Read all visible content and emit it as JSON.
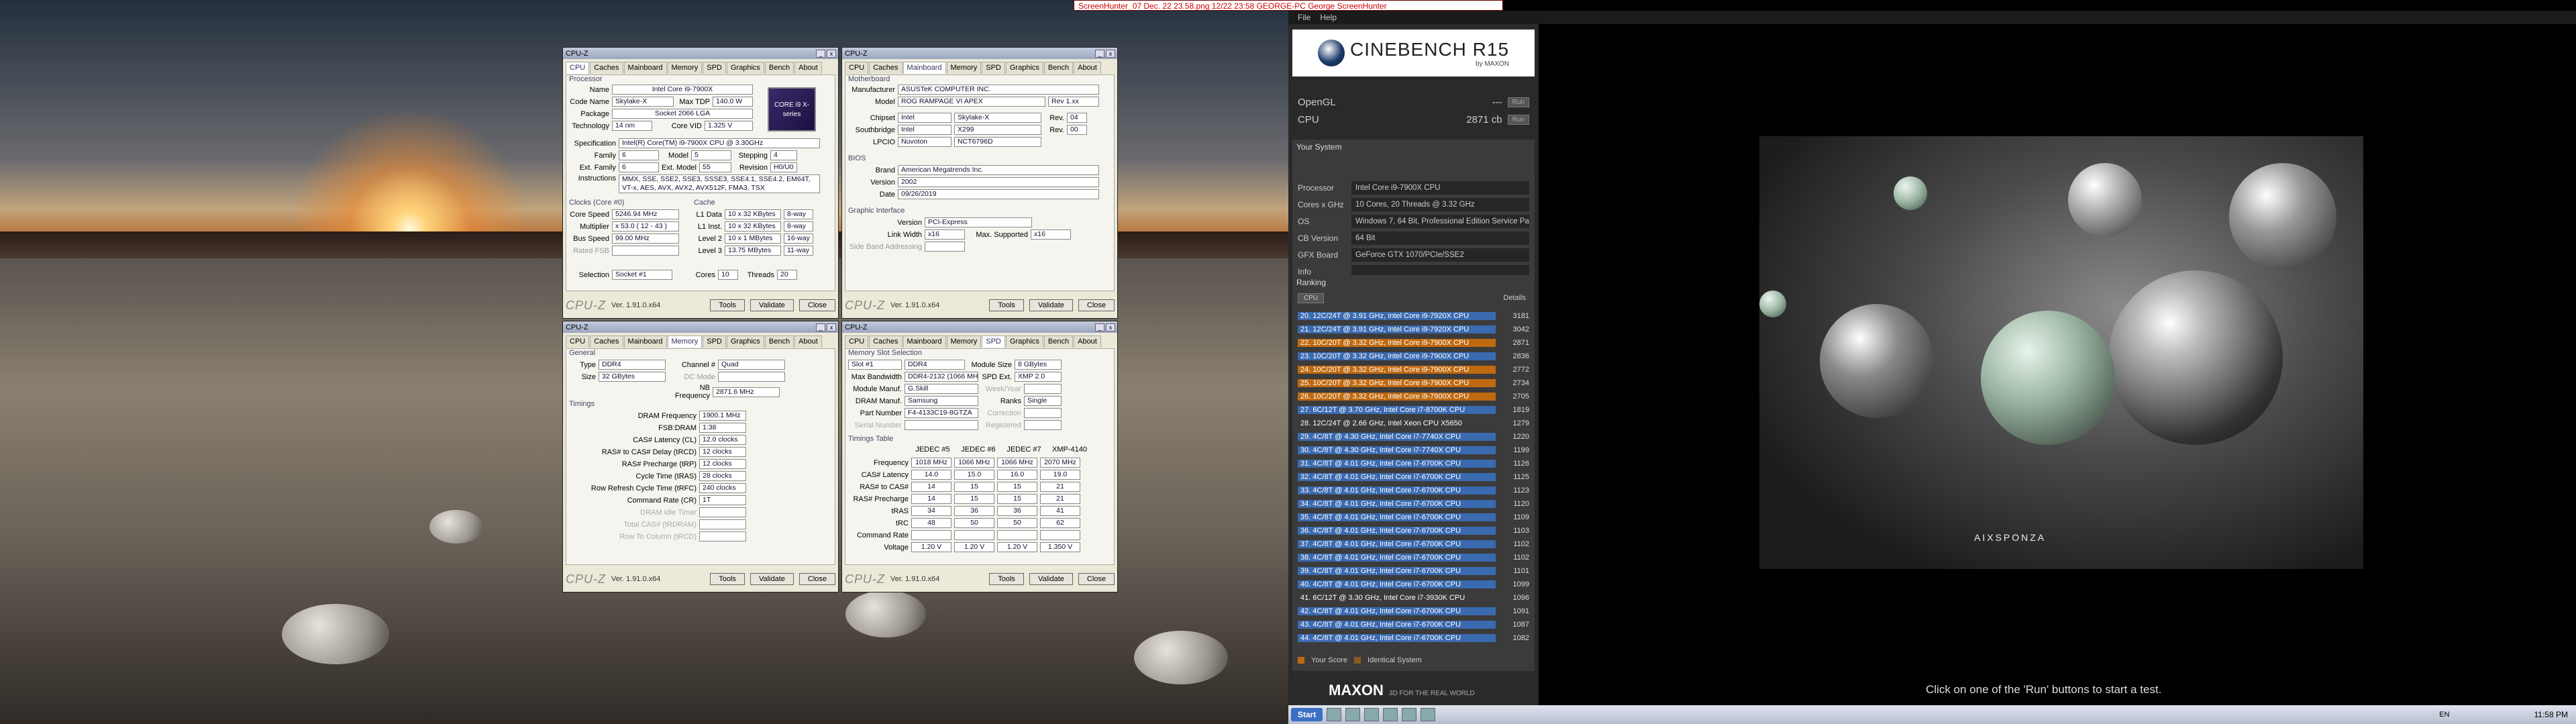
{
  "screenhunter_title": "ScreenHunter_07 Dec. 22 23.58.png  12/22 23:58  GEORGE-PC  George  ScreenHunter",
  "cpuz_processor": {
    "title": "CPU-Z",
    "tabs": [
      "CPU",
      "Caches",
      "Mainboard",
      "Memory",
      "SPD",
      "Graphics",
      "Bench",
      "About"
    ],
    "section_processor": "Processor",
    "name": "Intel Core i9-7900X",
    "code_name": "Skylake-X",
    "max_tdp": "140.0 W",
    "package": "Socket 2066 LGA",
    "technology": "14 nm",
    "core_vid": "1.325 V",
    "specification": "Intel(R) Core(TM) i9-7900X CPU @ 3.30GHz",
    "family": "6",
    "model": "5",
    "stepping": "4",
    "ext_family": "6",
    "ext_model": "55",
    "revision": "H0/U0",
    "instructions": "MMX, SSE, SSE2, SSE3, SSSE3, SSE4.1, SSE4.2, EM64T, VT-x, AES, AVX, AVX2, AVX512F, FMA3, TSX",
    "section_clocks": "Clocks (Core #0)",
    "core_speed": "5246.94 MHz",
    "multiplier": "x 53.0 ( 12 - 43 )",
    "bus_speed": "99.00 MHz",
    "rated_fsb": "",
    "section_cache": "Cache",
    "l1d": "10 x 32 KBytes",
    "l1d_way": "8-way",
    "l1i": "10 x 32 KBytes",
    "l1i_way": "8-way",
    "l2": "10 x 1 MBytes",
    "l2_way": "16-way",
    "l3": "13.75 MBytes",
    "l3_way": "11-way",
    "selection": "Socket #1",
    "cores": "10",
    "threads": "20",
    "brand_badge": "CORE i9 X-series",
    "labels": {
      "name": "Name",
      "code_name": "Code Name",
      "max_tdp": "Max TDP",
      "package": "Package",
      "technology": "Technology",
      "core_vid": "Core VID",
      "specification": "Specification",
      "family": "Family",
      "model": "Model",
      "stepping": "Stepping",
      "ext_family": "Ext. Family",
      "ext_model": "Ext. Model",
      "revision": "Revision",
      "instructions": "Instructions",
      "core_speed": "Core Speed",
      "multiplier": "Multiplier",
      "bus_speed": "Bus Speed",
      "rated_fsb": "Rated FSB",
      "l1d": "L1 Data",
      "l1i": "L1 Inst.",
      "l2": "Level 2",
      "l3": "Level 3",
      "selection": "Selection",
      "cores": "Cores",
      "threads": "Threads"
    },
    "footer": {
      "logo": "CPU-Z",
      "version": "Ver. 1.91.0.x64",
      "tools": "Tools",
      "validate": "Validate",
      "close": "Close"
    }
  },
  "cpuz_mainboard": {
    "title": "CPU-Z",
    "tabs": [
      "CPU",
      "Caches",
      "Mainboard",
      "Memory",
      "SPD",
      "Graphics",
      "Bench",
      "About"
    ],
    "section_motherboard": "Motherboard",
    "manufacturer": "ASUSTeK COMPUTER INC.",
    "model": "ROG RAMPAGE VI APEX",
    "model_rev": "Rev 1.xx",
    "chipset": "Intel",
    "chipset_name": "Skylake-X",
    "chipset_rev": "04",
    "southbridge": "Intel",
    "southbridge_name": "X299",
    "southbridge_rev": "00",
    "lpcio": "Nuvoton",
    "lpcio_name": "NCT6796D",
    "section_bios": "BIOS",
    "bios_brand": "American Megatrends Inc.",
    "bios_version": "2002",
    "bios_date": "09/26/2019",
    "section_gi": "Graphic Interface",
    "gi_version": "PCI-Express",
    "link_width": "x16",
    "max_supported": "x16",
    "side_band": "",
    "labels": {
      "manufacturer": "Manufacturer",
      "model": "Model",
      "chipset": "Chipset",
      "southbridge": "Southbridge",
      "lpcio": "LPCIO",
      "rev": "Rev.",
      "brand": "Brand",
      "version": "Version",
      "date": "Date",
      "link_width": "Link Width",
      "max_supported": "Max. Supported",
      "side_band": "Side Band Addressing"
    },
    "footer": {
      "logo": "CPU-Z",
      "version": "Ver. 1.91.0.x64",
      "tools": "Tools",
      "validate": "Validate",
      "close": "Close"
    }
  },
  "cpuz_memory": {
    "title": "CPU-Z",
    "tabs": [
      "CPU",
      "Caches",
      "Mainboard",
      "Memory",
      "SPD",
      "Graphics",
      "Bench",
      "About"
    ],
    "section_general": "General",
    "type": "DDR4",
    "channel": "Quad",
    "size": "32 GBytes",
    "dc_mode": "",
    "nb_frequency": "2871.6 MHz",
    "section_timings": "Timings",
    "dram_freq": "1900.1 MHz",
    "fsb_dram": "1:38",
    "cl": "12.0 clocks",
    "trcd": "12 clocks",
    "trp": "12 clocks",
    "tras": "28 clocks",
    "trfc": "240 clocks",
    "cr": "1T",
    "idle_timer": "",
    "total_cas": "",
    "row_to_col": "",
    "labels": {
      "type": "Type",
      "channel": "Channel #",
      "size": "Size",
      "dc_mode": "DC Mode",
      "nb_frequency": "NB Frequency",
      "dram_freq": "DRAM Frequency",
      "fsb_dram": "FSB:DRAM",
      "cl": "CAS# Latency (CL)",
      "trcd": "RAS# to CAS# Delay (tRCD)",
      "trp": "RAS# Precharge (tRP)",
      "tras": "Cycle Time (tRAS)",
      "trfc": "Row Refresh Cycle Time (tRFC)",
      "cr": "Command Rate (CR)",
      "idle_timer": "DRAM Idle Timer",
      "total_cas": "Total CAS# (tRDRAM)",
      "row_to_col": "Row To Column (tRCD)"
    },
    "footer": {
      "logo": "CPU-Z",
      "version": "Ver. 1.91.0.x64",
      "tools": "Tools",
      "validate": "Validate",
      "close": "Close"
    }
  },
  "cpuz_spd": {
    "title": "CPU-Z",
    "tabs": [
      "CPU",
      "Caches",
      "Mainboard",
      "Memory",
      "SPD",
      "Graphics",
      "Bench",
      "About"
    ],
    "section_slot": "Memory Slot Selection",
    "slot": "Slot #1",
    "slot_type": "DDR4",
    "module_size": "8 GBytes",
    "max_bandwidth": "DDR4-2132 (1066 MHz)",
    "spd_ext": "XMP 2.0",
    "module_manuf": "G.Skill",
    "week_year": "",
    "dram_manuf": "Samsung",
    "ranks": "Single",
    "part_number": "F4-4133C19-8GTZA",
    "correction": "",
    "serial_number": "",
    "registered": "",
    "section_timings": "Timings Table",
    "timing_headers": [
      "JEDEC #5",
      "JEDEC #6",
      "JEDEC #7",
      "XMP-4140"
    ],
    "timing_rows": [
      {
        "label": "Frequency",
        "values": [
          "1018 MHz",
          "1066 MHz",
          "1066 MHz",
          "2070 MHz"
        ]
      },
      {
        "label": "CAS# Latency",
        "values": [
          "14.0",
          "15.0",
          "16.0",
          "19.0"
        ]
      },
      {
        "label": "RAS# to CAS#",
        "values": [
          "14",
          "15",
          "15",
          "21"
        ]
      },
      {
        "label": "RAS# Precharge",
        "values": [
          "14",
          "15",
          "15",
          "21"
        ]
      },
      {
        "label": "tRAS",
        "values": [
          "34",
          "36",
          "36",
          "41"
        ]
      },
      {
        "label": "tRC",
        "values": [
          "48",
          "50",
          "50",
          "62"
        ]
      },
      {
        "label": "Command Rate",
        "values": [
          "",
          "",
          "",
          ""
        ]
      },
      {
        "label": "Voltage",
        "values": [
          "1.20 V",
          "1.20 V",
          "1.20 V",
          "1.350 V"
        ]
      }
    ],
    "labels": {
      "max_bandwidth": "Max Bandwidth",
      "module_manuf": "Module Manuf.",
      "dram_manuf": "DRAM Manuf.",
      "part_number": "Part Number",
      "serial_number": "Serial Number",
      "module_size": "Module Size",
      "spd_ext": "SPD Ext.",
      "week_year": "Week/Year",
      "ranks": "Ranks",
      "correction": "Correction",
      "registered": "Registered"
    },
    "footer": {
      "logo": "CPU-Z",
      "version": "Ver. 1.91.0.x64",
      "tools": "Tools",
      "validate": "Validate",
      "close": "Close"
    }
  },
  "cinebench": {
    "menu": [
      "File",
      "Help"
    ],
    "logo": "CINEBENCH R15",
    "logo_sub": "by MAXON",
    "opengl_label": "OpenGL",
    "opengl_value": "---",
    "cpu_label": "CPU",
    "cpu_value": "2871 cb",
    "run": "Run",
    "your_system_title": "Your System",
    "system": [
      {
        "k": "Processor",
        "v": "Intel Core i9-7900X CPU"
      },
      {
        "k": "Cores x GHz",
        "v": "10 Cores, 20 Threads @ 3.32 GHz"
      },
      {
        "k": "OS",
        "v": "Windows 7, 64 Bit, Professional Edition Service Pack 1 (b"
      },
      {
        "k": "CB Version",
        "v": "64 Bit"
      },
      {
        "k": "GFX Board",
        "v": "GeForce GTX 1070/PCIe/SSE2"
      },
      {
        "k": "Info",
        "v": ""
      }
    ],
    "ranking_title": "Ranking",
    "ranking_filter": "CPU",
    "details": "Details",
    "ranking": [
      {
        "label": "20. 12C/24T @ 3.91 GHz, Intel Core i9-7920X CPU",
        "score": "3181",
        "hl": "blue"
      },
      {
        "label": "21. 12C/24T @ 3.91 GHz, Intel Core i9-7920X CPU",
        "score": "3042",
        "hl": "blue"
      },
      {
        "label": "22. 10C/20T @ 3.32 GHz, Intel Core i9-7900X CPU",
        "score": "2871",
        "hl": "orange"
      },
      {
        "label": "23. 10C/20T @ 3.32 GHz, Intel Core i9-7900X CPU",
        "score": "2836",
        "hl": "blue"
      },
      {
        "label": "24. 10C/20T @ 3.32 GHz, Intel Core i9-7900X CPU",
        "score": "2772",
        "hl": "orange"
      },
      {
        "label": "25. 10C/20T @ 3.32 GHz, Intel Core i9-7900X CPU",
        "score": "2734",
        "hl": "orange"
      },
      {
        "label": "26. 10C/20T @ 3.32 GHz, Intel Core i9-7900X CPU",
        "score": "2705",
        "hl": "orange"
      },
      {
        "label": "27. 6C/12T @ 3.70 GHz, Intel Core i7-8700K CPU",
        "score": "1819",
        "hl": "blue"
      },
      {
        "label": "28. 12C/24T @ 2.66 GHz, Intel Xeon CPU X5650",
        "score": "1279",
        "hl": "none"
      },
      {
        "label": "29. 4C/8T @ 4.30 GHz, Intel Core i7-7740X CPU",
        "score": "1220",
        "hl": "blue"
      },
      {
        "label": "30. 4C/8T @ 4.30 GHz, Intel Core i7-7740X CPU",
        "score": "1199",
        "hl": "blue"
      },
      {
        "label": "31. 4C/8T @ 4.01 GHz, Intel Core i7-6700K CPU",
        "score": "1126",
        "hl": "blue"
      },
      {
        "label": "32. 4C/8T @ 4.01 GHz, Intel Core i7-6700K CPU",
        "score": "1125",
        "hl": "blue"
      },
      {
        "label": "33. 4C/8T @ 4.01 GHz, Intel Core i7-6700K CPU",
        "score": "1123",
        "hl": "blue"
      },
      {
        "label": "34. 4C/8T @ 4.01 GHz, Intel Core i7-6700K CPU",
        "score": "1120",
        "hl": "blue"
      },
      {
        "label": "35. 4C/8T @ 4.01 GHz, Intel Core i7-6700K CPU",
        "score": "1109",
        "hl": "blue"
      },
      {
        "label": "36. 4C/8T @ 4.01 GHz, Intel Core i7-6700K CPU",
        "score": "1103",
        "hl": "blue"
      },
      {
        "label": "37. 4C/8T @ 4.01 GHz, Intel Core i7-6700K CPU",
        "score": "1102",
        "hl": "blue"
      },
      {
        "label": "38. 4C/8T @ 4.01 GHz, Intel Core i7-6700K CPU",
        "score": "1102",
        "hl": "blue"
      },
      {
        "label": "39. 4C/8T @ 4.01 GHz, Intel Core i7-6700K CPU",
        "score": "1101",
        "hl": "blue"
      },
      {
        "label": "40. 4C/8T @ 4.01 GHz, Intel Core i7-6700K CPU",
        "score": "1099",
        "hl": "blue"
      },
      {
        "label": "41. 6C/12T @ 3.30 GHz, Intel Core i7-3930K CPU",
        "score": "1096",
        "hl": "none"
      },
      {
        "label": "42. 4C/8T @ 4.01 GHz, Intel Core i7-6700K CPU",
        "score": "1091",
        "hl": "blue"
      },
      {
        "label": "43. 4C/8T @ 4.01 GHz, Intel Core i7-6700K CPU",
        "score": "1087",
        "hl": "blue"
      },
      {
        "label": "44. 4C/8T @ 4.01 GHz, Intel Core i7-6700K CPU",
        "score": "1082",
        "hl": "blue"
      }
    ],
    "legend_your_score": "Your Score",
    "legend_identical": "Identical System",
    "footer_brand": "MAXON",
    "footer_tagline": "3D FOR THE REAL WORLD",
    "render_brand": "AIXSPONZA",
    "hint": "Click on one of the 'Run' buttons to start a test."
  },
  "taskbar": {
    "start": "Start",
    "lang": "EN",
    "clock": "11:58 PM"
  },
  "colors": {
    "orange": "#c06a10",
    "blue": "#3a6ab0",
    "cb_panel": "#2a2a2a"
  }
}
